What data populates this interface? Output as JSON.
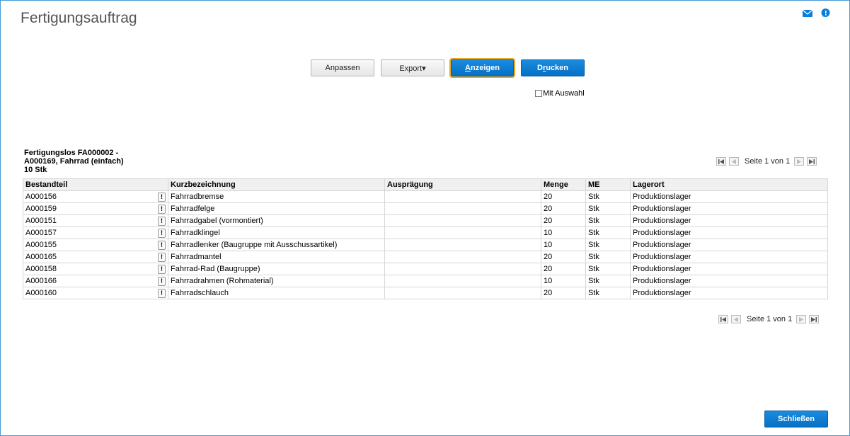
{
  "window": {
    "title": "Fertigungsauftrag"
  },
  "toolbar": {
    "anpassen": "Anpassen",
    "export": "Export▾",
    "anzeigen_first": "A",
    "anzeigen_rest": "nzeigen",
    "drucken_first": "D",
    "drucken_u": "r",
    "drucken_rest": "ucken",
    "mit_auswahl": "Mit Auswahl",
    "mit_auswahl_checked": false
  },
  "report": {
    "line1": "Fertigungslos FA000002 -",
    "line2": "A000169, Fahrrad (einfach)",
    "line3": "10 Stk"
  },
  "pager_top": {
    "text": "Seite 1 von 1"
  },
  "pager_bottom": {
    "text": "Seite 1 von 1"
  },
  "table": {
    "columns": [
      "Bestandteil",
      "Kurzbezeichnung",
      "Ausprägung",
      "Menge",
      "ME",
      "Lagerort"
    ],
    "rows": [
      [
        "A000156",
        "Fahrradbremse",
        "",
        "20",
        "Stk",
        "Produktionslager"
      ],
      [
        "A000159",
        "Fahrradfelge",
        "",
        "20",
        "Stk",
        "Produktionslager"
      ],
      [
        "A000151",
        "Fahrradgabel (vormontiert)",
        "",
        "20",
        "Stk",
        "Produktionslager"
      ],
      [
        "A000157",
        "Fahrradklingel",
        "",
        "10",
        "Stk",
        "Produktionslager"
      ],
      [
        "A000155",
        "Fahrradlenker (Baugruppe mit Ausschussartikel)",
        "",
        "10",
        "Stk",
        "Produktionslager"
      ],
      [
        "A000165",
        "Fahrradmantel",
        "",
        "20",
        "Stk",
        "Produktionslager"
      ],
      [
        "A000158",
        "Fahrrad-Rad (Baugruppe)",
        "",
        "20",
        "Stk",
        "Produktionslager"
      ],
      [
        "A000166",
        "Fahrradrahmen (Rohmaterial)",
        "",
        "10",
        "Stk",
        "Produktionslager"
      ],
      [
        "A000160",
        "Fahrradschlauch",
        "",
        "20",
        "Stk",
        "Produktionslager"
      ]
    ],
    "info_symbol": "!"
  },
  "footer": {
    "close": "Schließen"
  },
  "colors": {
    "accent": "#0670c4",
    "focus": "#e5a823"
  },
  "icons": [
    "mail-icon",
    "help-icon",
    "first-page-icon",
    "prev-page-icon",
    "next-page-icon",
    "last-page-icon",
    "info-icon"
  ]
}
